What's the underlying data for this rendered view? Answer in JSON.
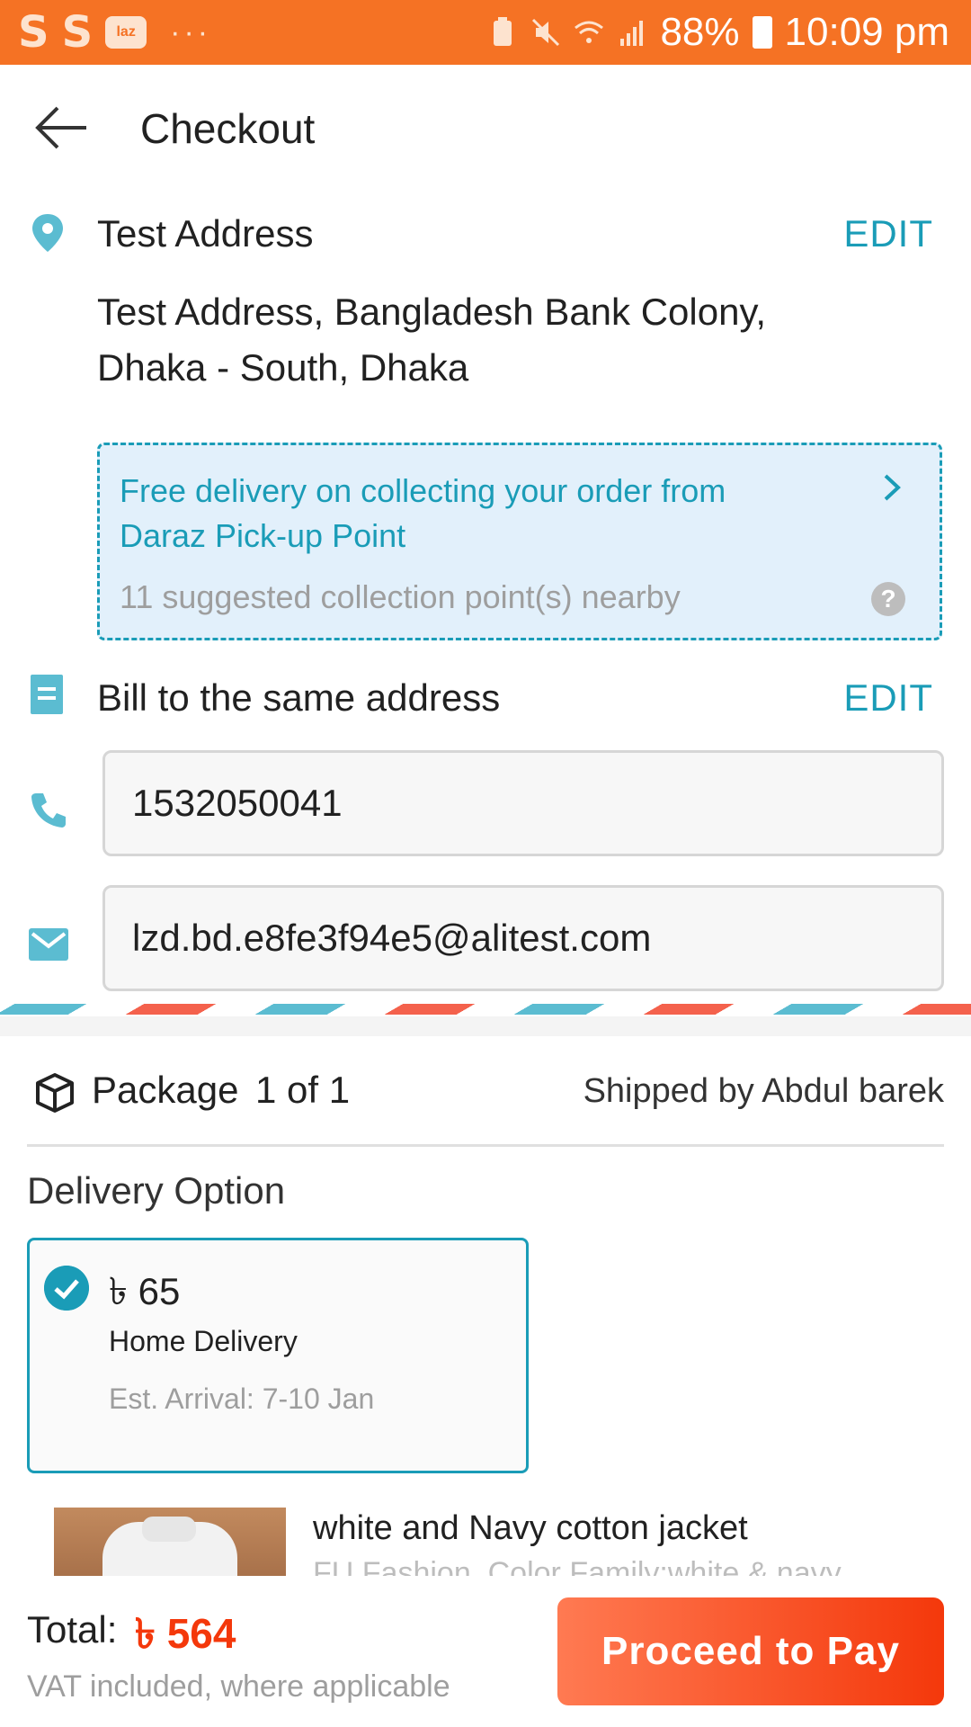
{
  "status_bar": {
    "icon_1": "S",
    "icon_2": "S",
    "app_badge": "laz",
    "more": "···",
    "battery": "88%",
    "time": "10:09 pm"
  },
  "header": {
    "title": "Checkout"
  },
  "address": {
    "name": "Test Address",
    "edit_label": "EDIT",
    "lines": "Test Address, Bangladesh Bank Colony, Dhaka - South, Dhaka"
  },
  "pickup": {
    "title": "Free delivery on collecting your order from Daraz Pick-up Point",
    "subtitle": "11 suggested collection point(s) nearby",
    "help": "?"
  },
  "billing": {
    "label": "Bill to the same address",
    "edit_label": "EDIT"
  },
  "contact": {
    "phone": "1532050041",
    "email": "lzd.bd.e8fe3f94e5@alitest.com"
  },
  "package": {
    "label": "Package",
    "count": "1 of 1",
    "shipped_by": "Shipped by Abdul barek"
  },
  "delivery": {
    "title": "Delivery Option",
    "price": "৳ 65",
    "method": "Home Delivery",
    "eta": "Est. Arrival: 7-10 Jan"
  },
  "product": {
    "name": "white and Navy cotton jacket",
    "subtitle": "FU Fashion, Color Family:white & navy"
  },
  "footer": {
    "total_label": "Total:",
    "total_value": "৳ 564",
    "vat_note": "VAT included, where applicable",
    "pay_label": "Proceed to Pay"
  },
  "colors": {
    "accent": "#f57224",
    "link": "#1a9cb7",
    "price": "#f4380b"
  }
}
